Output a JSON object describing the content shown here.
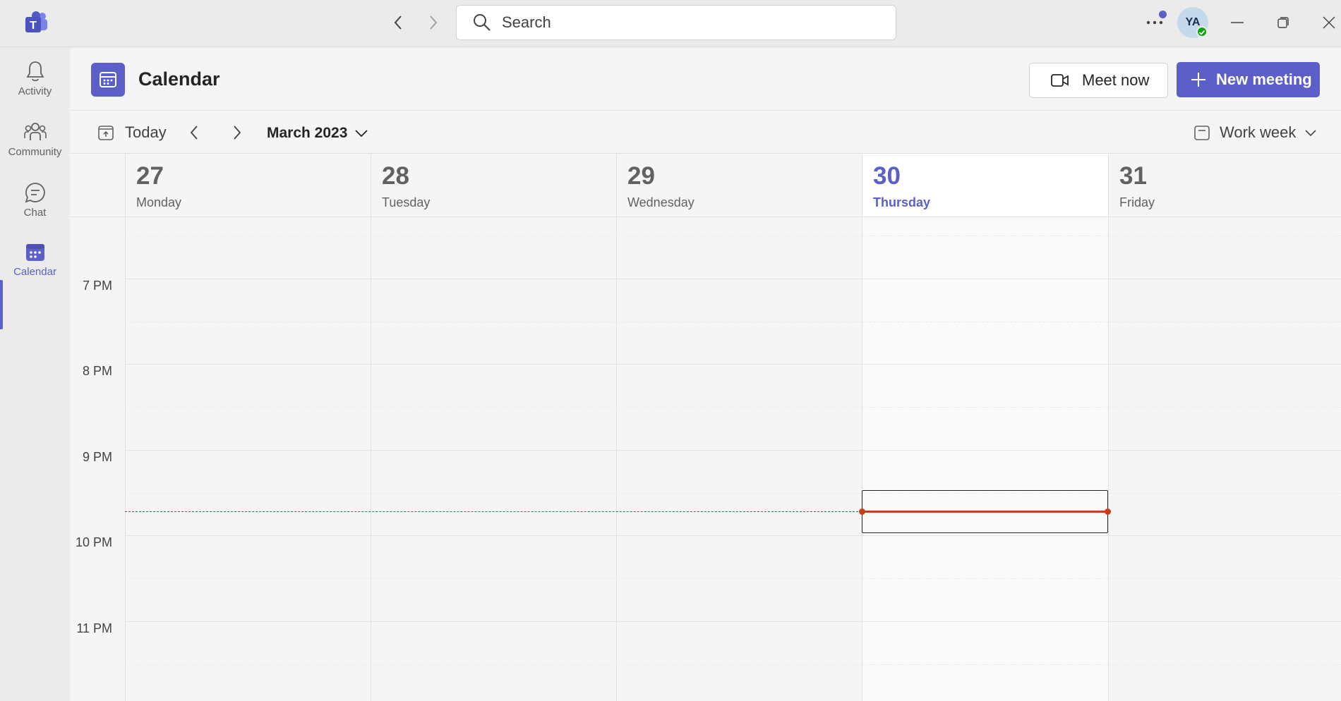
{
  "titlebar": {
    "search_placeholder": "Search",
    "avatar_initials": "YA",
    "presence_status": "available",
    "accent": "#5b5fc7"
  },
  "rail": {
    "items": [
      {
        "label": "Activity",
        "icon": "bell-icon"
      },
      {
        "label": "Community",
        "icon": "community-icon"
      },
      {
        "label": "Chat",
        "icon": "chat-icon"
      },
      {
        "label": "Calendar",
        "icon": "calendar-icon",
        "active": true
      }
    ]
  },
  "header": {
    "title": "Calendar",
    "meet_now_label": "Meet now",
    "new_meeting_label": "New meeting"
  },
  "toolbar": {
    "today_label": "Today",
    "month_label": "March 2023",
    "view_label": "Work week"
  },
  "days": [
    {
      "num": "27",
      "name": "Monday"
    },
    {
      "num": "28",
      "name": "Tuesday"
    },
    {
      "num": "29",
      "name": "Wednesday"
    },
    {
      "num": "30",
      "name": "Thursday",
      "today": true
    },
    {
      "num": "31",
      "name": "Friday"
    }
  ],
  "times": [
    "7 PM",
    "8 PM",
    "9 PM",
    "10 PM",
    "11 PM"
  ],
  "colors": {
    "brand": "#5b5fc7",
    "current_time_line": "#c4401a"
  }
}
